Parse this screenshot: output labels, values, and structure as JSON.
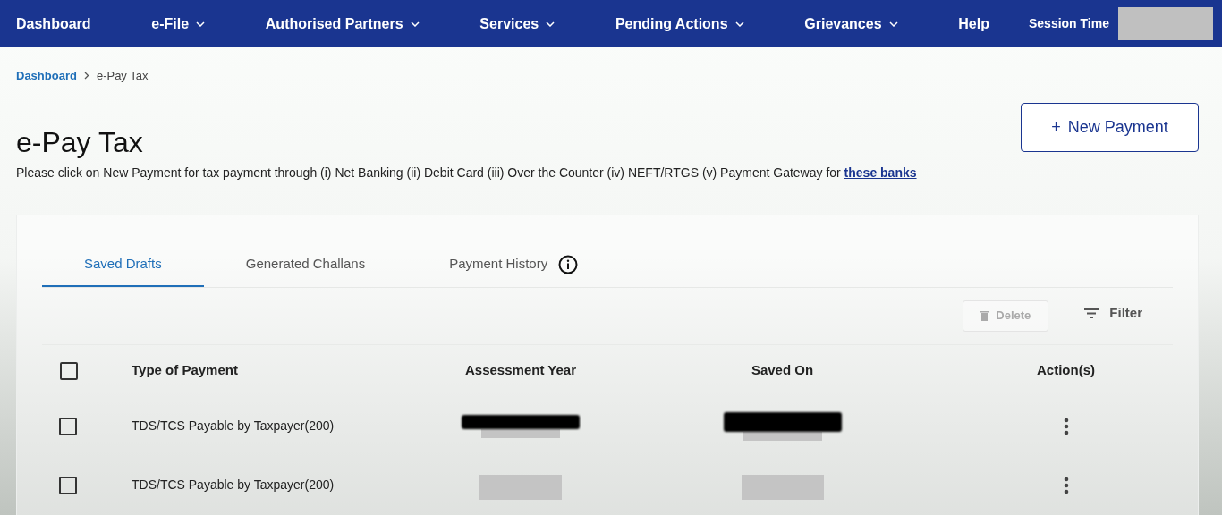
{
  "nav": {
    "items": [
      {
        "label": "Dashboard",
        "dropdown": false
      },
      {
        "label": "e-File",
        "dropdown": true
      },
      {
        "label": "Authorised Partners",
        "dropdown": true
      },
      {
        "label": "Services",
        "dropdown": true
      },
      {
        "label": "Pending Actions",
        "dropdown": true
      },
      {
        "label": "Grievances",
        "dropdown": true
      },
      {
        "label": "Help",
        "dropdown": false
      }
    ],
    "session_label": "Session Time"
  },
  "breadcrumb": [
    {
      "label": "Dashboard",
      "link": true
    },
    {
      "label": "e-Pay Tax",
      "link": false
    }
  ],
  "title": "e-Pay Tax",
  "description": {
    "text": "Please click on New Payment for tax payment through (i) Net Banking (ii) Debit Card (iii) Over the Counter (iv) NEFT/RTGS (v) Payment Gateway for",
    "link": "these banks"
  },
  "new_payment": {
    "icon": "+",
    "label": "New Payment"
  },
  "tabs": [
    {
      "label": "Saved Drafts",
      "selected": true,
      "info": false
    },
    {
      "label": "Generated Challans",
      "selected": false,
      "info": false
    },
    {
      "label": "Payment History",
      "selected": false,
      "info": true
    }
  ],
  "toolbar": {
    "delete": {
      "label": "Delete",
      "disabled": true
    },
    "filter": "Filter"
  },
  "table": {
    "select_all": {
      "checked": false
    },
    "columns": [
      "Type of Payment",
      "Assessment Year",
      "Saved On",
      "Action(s)"
    ],
    "rows": [
      {
        "checked": false,
        "type": "TDS/TCS Payable by Taxpayer(200)",
        "black_bars": true
      },
      {
        "checked": false,
        "type": "TDS/TCS Payable by Taxpayer(200)",
        "black_bars": false
      }
    ]
  }
}
